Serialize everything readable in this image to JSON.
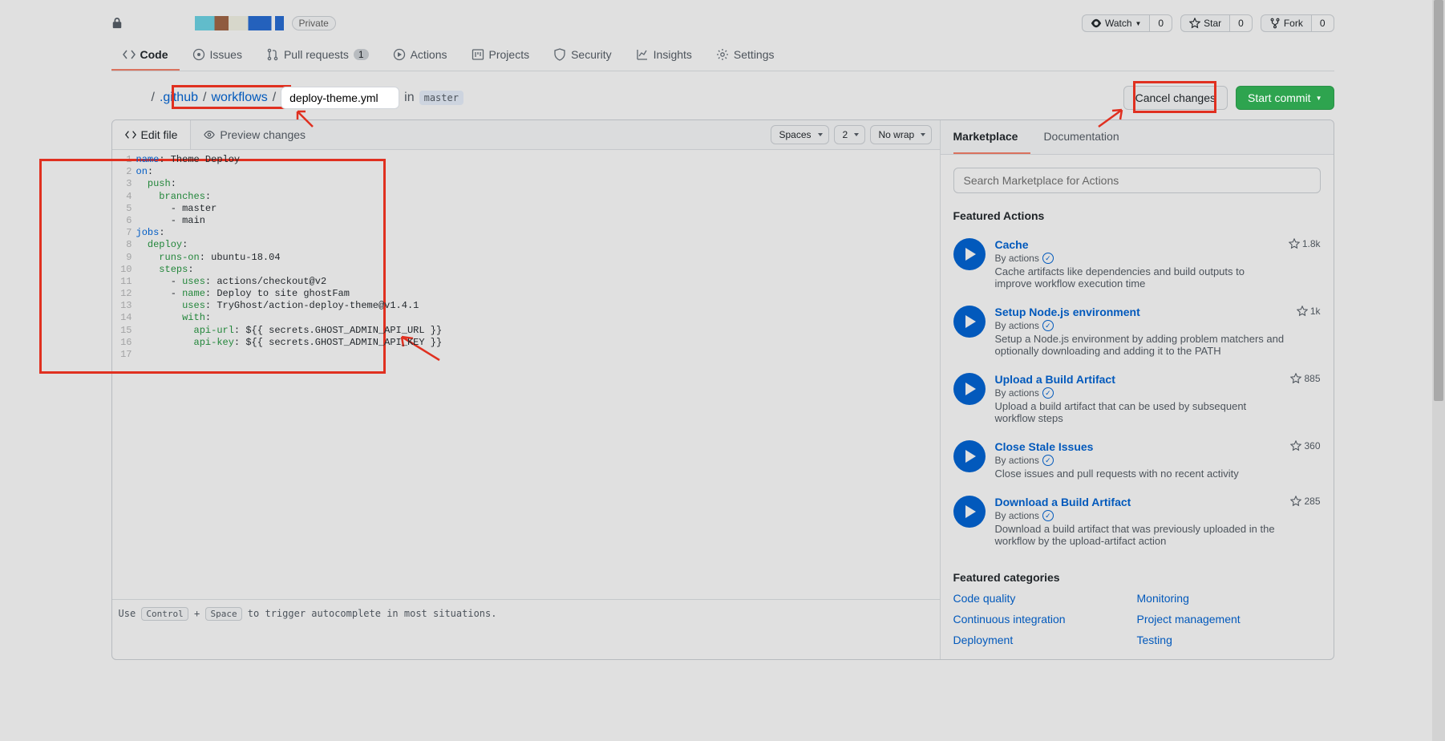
{
  "header": {
    "privacy_badge": "Private",
    "watch": {
      "label": "Watch",
      "count": "0"
    },
    "star": {
      "label": "Star",
      "count": "0"
    },
    "fork": {
      "label": "Fork",
      "count": "0"
    }
  },
  "tabs": {
    "code": "Code",
    "issues": "Issues",
    "pulls": "Pull requests",
    "pulls_count": "1",
    "actions": "Actions",
    "projects": "Projects",
    "security": "Security",
    "insights": "Insights",
    "settings": "Settings"
  },
  "breadcrumb": {
    "seg1": ".github",
    "seg2": "workflows",
    "filename": "deploy-theme.yml",
    "in": "in",
    "branch": "master",
    "cancel": "Cancel changes",
    "commit": "Start commit"
  },
  "editor": {
    "edit_tab": "Edit file",
    "preview_tab": "Preview changes",
    "indent_mode": "Spaces",
    "indent_size": "2",
    "wrap": "No wrap",
    "footer_pre": "Use ",
    "kbd1": "Control",
    "plus": " + ",
    "kbd2": "Space",
    "footer_post": " to trigger autocomplete in most situations."
  },
  "code": {
    "l1a": "name",
    "l1b": ": Theme Deploy",
    "l2a": "on",
    "l2b": ":",
    "l3a": "  push",
    "l3b": ":",
    "l4a": "    branches",
    "l4b": ":",
    "l5": "      - master",
    "l6": "      - main",
    "l7a": "jobs",
    "l7b": ":",
    "l8a": "  deploy",
    "l8b": ":",
    "l9a": "    runs-on",
    "l9b": ": ubuntu-18.04",
    "l10a": "    steps",
    "l10b": ":",
    "l11a": "      - ",
    "l11b": "uses",
    "l11c": ": actions/checkout@v2",
    "l12a": "      - ",
    "l12b": "name",
    "l12c": ": Deploy to site ghostFam",
    "l13a": "        uses",
    "l13b": ": TryGhost/action-deploy-theme@v1.4.1",
    "l14a": "        with",
    "l14b": ":",
    "l15a": "          api-url",
    "l15b": ": ${{ secrets.GHOST_ADMIN_API_URL }}",
    "l16a": "          api-key",
    "l16b": ": ${{ secrets.GHOST_ADMIN_API_KEY }}"
  },
  "lines": [
    "1",
    "2",
    "3",
    "4",
    "5",
    "6",
    "7",
    "8",
    "9",
    "10",
    "11",
    "12",
    "13",
    "14",
    "15",
    "16",
    "17"
  ],
  "sidebar": {
    "marketplace_tab": "Marketplace",
    "docs_tab": "Documentation",
    "search_placeholder": "Search Marketplace for Actions",
    "featured_heading": "Featured Actions",
    "by_prefix": "By ",
    "actions": [
      {
        "title": "Cache",
        "author": "actions",
        "stars": "1.8k",
        "desc": "Cache artifacts like dependencies and build outputs to improve workflow execution time"
      },
      {
        "title": "Setup Node.js environment",
        "author": "actions",
        "stars": "1k",
        "desc": "Setup a Node.js environment by adding problem matchers and optionally downloading and adding it to the PATH"
      },
      {
        "title": "Upload a Build Artifact",
        "author": "actions",
        "stars": "885",
        "desc": "Upload a build artifact that can be used by subsequent workflow steps"
      },
      {
        "title": "Close Stale Issues",
        "author": "actions",
        "stars": "360",
        "desc": "Close issues and pull requests with no recent activity"
      },
      {
        "title": "Download a Build Artifact",
        "author": "actions",
        "stars": "285",
        "desc": "Download a build artifact that was previously uploaded in the workflow by the upload-artifact action"
      }
    ],
    "cats_heading": "Featured categories",
    "cats": [
      "Code quality",
      "Monitoring",
      "Continuous integration",
      "Project management",
      "Deployment",
      "Testing"
    ]
  }
}
